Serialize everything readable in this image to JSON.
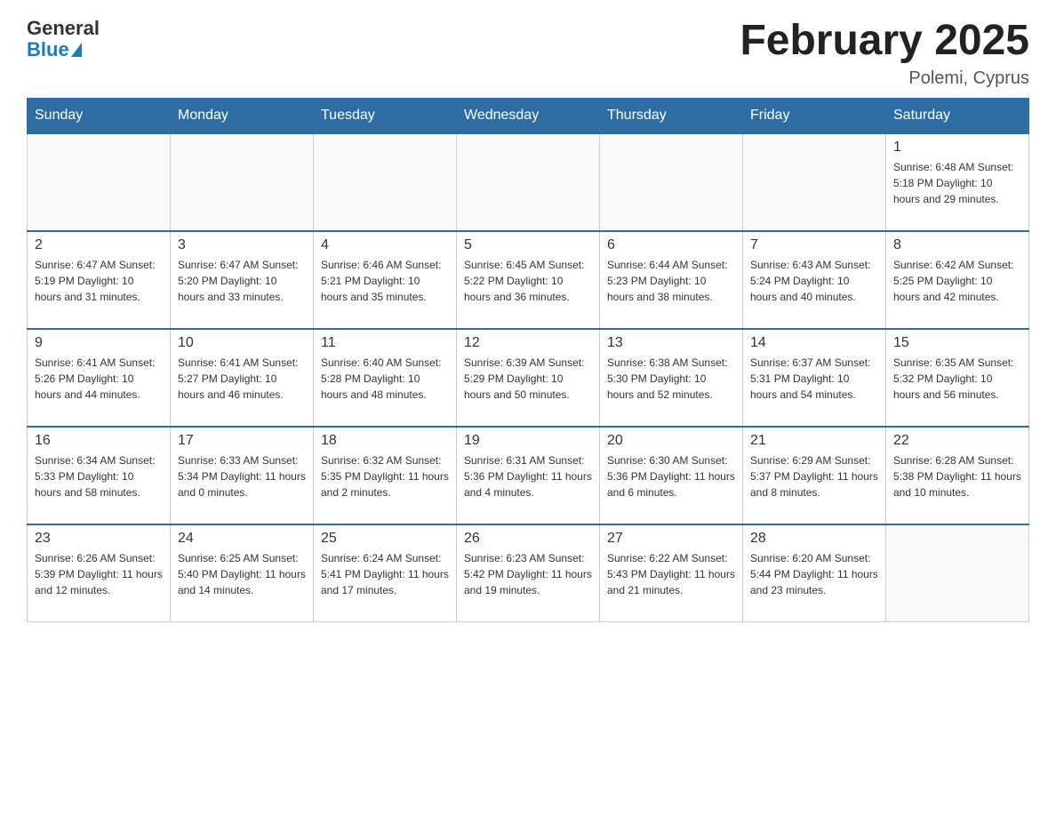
{
  "header": {
    "logo_general": "General",
    "logo_blue": "Blue",
    "title": "February 2025",
    "location": "Polemi, Cyprus"
  },
  "days_of_week": [
    "Sunday",
    "Monday",
    "Tuesday",
    "Wednesday",
    "Thursday",
    "Friday",
    "Saturday"
  ],
  "weeks": [
    [
      {
        "day": "",
        "info": ""
      },
      {
        "day": "",
        "info": ""
      },
      {
        "day": "",
        "info": ""
      },
      {
        "day": "",
        "info": ""
      },
      {
        "day": "",
        "info": ""
      },
      {
        "day": "",
        "info": ""
      },
      {
        "day": "1",
        "info": "Sunrise: 6:48 AM\nSunset: 5:18 PM\nDaylight: 10 hours and 29 minutes."
      }
    ],
    [
      {
        "day": "2",
        "info": "Sunrise: 6:47 AM\nSunset: 5:19 PM\nDaylight: 10 hours and 31 minutes."
      },
      {
        "day": "3",
        "info": "Sunrise: 6:47 AM\nSunset: 5:20 PM\nDaylight: 10 hours and 33 minutes."
      },
      {
        "day": "4",
        "info": "Sunrise: 6:46 AM\nSunset: 5:21 PM\nDaylight: 10 hours and 35 minutes."
      },
      {
        "day": "5",
        "info": "Sunrise: 6:45 AM\nSunset: 5:22 PM\nDaylight: 10 hours and 36 minutes."
      },
      {
        "day": "6",
        "info": "Sunrise: 6:44 AM\nSunset: 5:23 PM\nDaylight: 10 hours and 38 minutes."
      },
      {
        "day": "7",
        "info": "Sunrise: 6:43 AM\nSunset: 5:24 PM\nDaylight: 10 hours and 40 minutes."
      },
      {
        "day": "8",
        "info": "Sunrise: 6:42 AM\nSunset: 5:25 PM\nDaylight: 10 hours and 42 minutes."
      }
    ],
    [
      {
        "day": "9",
        "info": "Sunrise: 6:41 AM\nSunset: 5:26 PM\nDaylight: 10 hours and 44 minutes."
      },
      {
        "day": "10",
        "info": "Sunrise: 6:41 AM\nSunset: 5:27 PM\nDaylight: 10 hours and 46 minutes."
      },
      {
        "day": "11",
        "info": "Sunrise: 6:40 AM\nSunset: 5:28 PM\nDaylight: 10 hours and 48 minutes."
      },
      {
        "day": "12",
        "info": "Sunrise: 6:39 AM\nSunset: 5:29 PM\nDaylight: 10 hours and 50 minutes."
      },
      {
        "day": "13",
        "info": "Sunrise: 6:38 AM\nSunset: 5:30 PM\nDaylight: 10 hours and 52 minutes."
      },
      {
        "day": "14",
        "info": "Sunrise: 6:37 AM\nSunset: 5:31 PM\nDaylight: 10 hours and 54 minutes."
      },
      {
        "day": "15",
        "info": "Sunrise: 6:35 AM\nSunset: 5:32 PM\nDaylight: 10 hours and 56 minutes."
      }
    ],
    [
      {
        "day": "16",
        "info": "Sunrise: 6:34 AM\nSunset: 5:33 PM\nDaylight: 10 hours and 58 minutes."
      },
      {
        "day": "17",
        "info": "Sunrise: 6:33 AM\nSunset: 5:34 PM\nDaylight: 11 hours and 0 minutes."
      },
      {
        "day": "18",
        "info": "Sunrise: 6:32 AM\nSunset: 5:35 PM\nDaylight: 11 hours and 2 minutes."
      },
      {
        "day": "19",
        "info": "Sunrise: 6:31 AM\nSunset: 5:36 PM\nDaylight: 11 hours and 4 minutes."
      },
      {
        "day": "20",
        "info": "Sunrise: 6:30 AM\nSunset: 5:36 PM\nDaylight: 11 hours and 6 minutes."
      },
      {
        "day": "21",
        "info": "Sunrise: 6:29 AM\nSunset: 5:37 PM\nDaylight: 11 hours and 8 minutes."
      },
      {
        "day": "22",
        "info": "Sunrise: 6:28 AM\nSunset: 5:38 PM\nDaylight: 11 hours and 10 minutes."
      }
    ],
    [
      {
        "day": "23",
        "info": "Sunrise: 6:26 AM\nSunset: 5:39 PM\nDaylight: 11 hours and 12 minutes."
      },
      {
        "day": "24",
        "info": "Sunrise: 6:25 AM\nSunset: 5:40 PM\nDaylight: 11 hours and 14 minutes."
      },
      {
        "day": "25",
        "info": "Sunrise: 6:24 AM\nSunset: 5:41 PM\nDaylight: 11 hours and 17 minutes."
      },
      {
        "day": "26",
        "info": "Sunrise: 6:23 AM\nSunset: 5:42 PM\nDaylight: 11 hours and 19 minutes."
      },
      {
        "day": "27",
        "info": "Sunrise: 6:22 AM\nSunset: 5:43 PM\nDaylight: 11 hours and 21 minutes."
      },
      {
        "day": "28",
        "info": "Sunrise: 6:20 AM\nSunset: 5:44 PM\nDaylight: 11 hours and 23 minutes."
      },
      {
        "day": "",
        "info": ""
      }
    ]
  ]
}
